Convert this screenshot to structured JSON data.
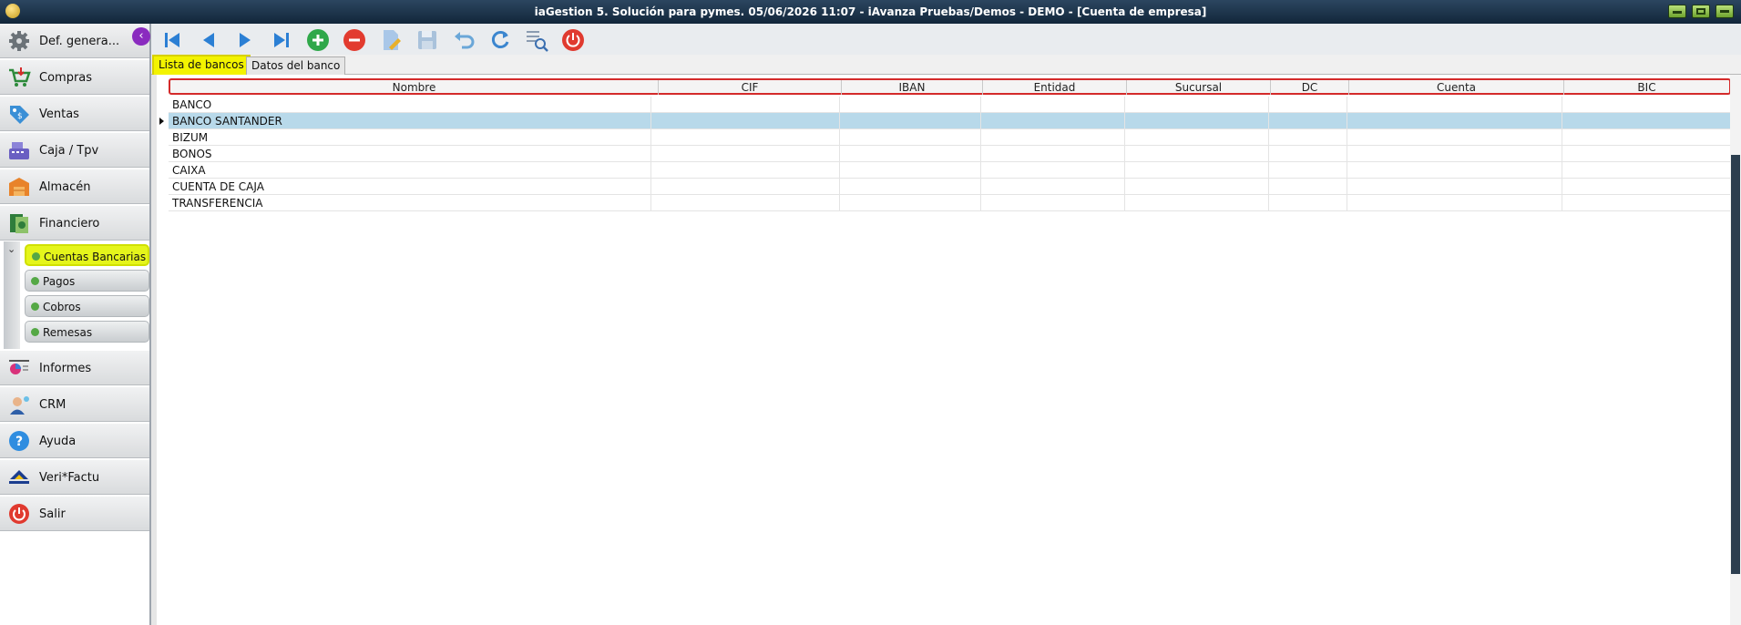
{
  "window": {
    "title": "iaGestion 5. Solución para pymes.   05/06/2026 11:07   -   iAvanza Pruebas/Demos - DEMO - [Cuenta de empresa]"
  },
  "sidebar": {
    "items": [
      {
        "label": "Def. genera...",
        "icon": "gear-icon"
      },
      {
        "label": "Compras",
        "icon": "shopping-cart-icon"
      },
      {
        "label": "Ventas",
        "icon": "sales-tag-icon"
      },
      {
        "label": "Caja / Tpv",
        "icon": "cash-register-icon"
      },
      {
        "label": "Almacén",
        "icon": "warehouse-box-icon"
      },
      {
        "label": "Financiero",
        "icon": "money-icon"
      },
      {
        "label": "Informes",
        "icon": "report-chart-icon"
      },
      {
        "label": "CRM",
        "icon": "crm-person-icon"
      },
      {
        "label": "Ayuda",
        "icon": "help-icon"
      },
      {
        "label": "Veri*Factu",
        "icon": "verifactu-icon"
      },
      {
        "label": "Salir",
        "icon": "power-icon"
      }
    ],
    "financiero_submenu": [
      {
        "label": "Cuentas Bancarias",
        "active": true
      },
      {
        "label": "Pagos",
        "active": false
      },
      {
        "label": "Cobros",
        "active": false
      },
      {
        "label": "Remesas",
        "active": false
      }
    ]
  },
  "toolbar": {
    "buttons": [
      "first-record-icon",
      "previous-record-icon",
      "next-record-icon",
      "last-record-icon",
      "add-icon",
      "delete-icon",
      "edit-document-icon",
      "save-icon",
      "undo-icon",
      "refresh-icon",
      "search-list-icon",
      "power-icon"
    ]
  },
  "tabs": [
    {
      "label": "Lista de bancos",
      "active": true
    },
    {
      "label": "Datos del banco",
      "active": false
    }
  ],
  "table": {
    "columns": [
      "Nombre",
      "CIF",
      "IBAN",
      "Entidad",
      "Sucursal",
      "DC",
      "Cuenta",
      "BIC"
    ],
    "rows": [
      "BANCO",
      "BANCO SANTANDER",
      "BIZUM",
      "BONOS",
      "CAIXA",
      "CUENTA DE CAJA",
      "TRANSFERENCIA"
    ],
    "selected_row": "BANCO SANTANDER"
  },
  "colors": {
    "titlebar": "#1c3550",
    "active_highlight": "#f3f300",
    "selected_row": "#b8d9ea",
    "header_outline": "#d42a2a"
  }
}
